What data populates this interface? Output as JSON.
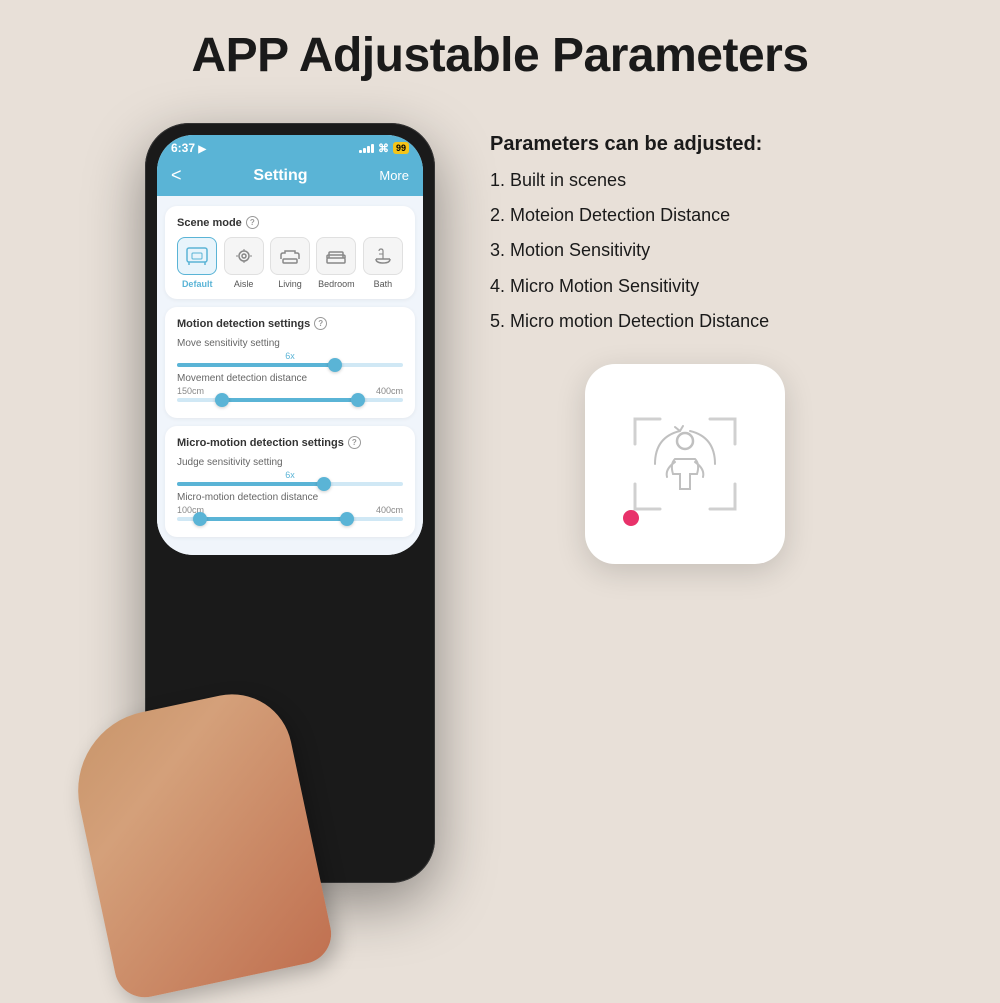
{
  "page": {
    "title": "APP Adjustable Parameters",
    "background": "#e8e0d8"
  },
  "phone": {
    "status": {
      "time": "6:37",
      "location_icon": "▶",
      "battery": "99"
    },
    "nav": {
      "back": "<",
      "title": "Setting",
      "more": "More"
    },
    "scene_mode": {
      "label": "Scene mode",
      "help": "?",
      "items": [
        {
          "id": "default",
          "label": "Default",
          "active": true
        },
        {
          "id": "aisle",
          "label": "Aisle",
          "active": false
        },
        {
          "id": "living",
          "label": "Living",
          "active": false
        },
        {
          "id": "bedroom",
          "label": "Bedroom",
          "active": false
        },
        {
          "id": "bath",
          "label": "Bath",
          "active": false
        }
      ]
    },
    "motion_detection": {
      "label": "Motion detection settings",
      "help": "?",
      "sensitivity": {
        "label": "Move sensitivity setting",
        "value": "6x",
        "fill_pct": 70
      },
      "distance": {
        "label": "Movement detection distance",
        "min_label": "150cm",
        "max_label": "400cm",
        "left_pct": 20,
        "right_pct": 80
      }
    },
    "micro_motion": {
      "label": "Micro-motion detection settings",
      "help": "?",
      "sensitivity": {
        "label": "Judge sensitivity setting",
        "value": "6x",
        "fill_pct": 65
      },
      "distance": {
        "label": "Micro-motion detection distance",
        "min_label": "100cm",
        "max_label": "400cm",
        "left_pct": 10,
        "right_pct": 75
      }
    }
  },
  "params": {
    "title": "Parameters can be adjusted:",
    "items": [
      "1. Built in scenes",
      "2. Moteion Detection Distance",
      "3. Motion Sensitivity",
      "4. Micro Motion Sensitivity",
      "5. Micro motion Detection Distance"
    ]
  }
}
